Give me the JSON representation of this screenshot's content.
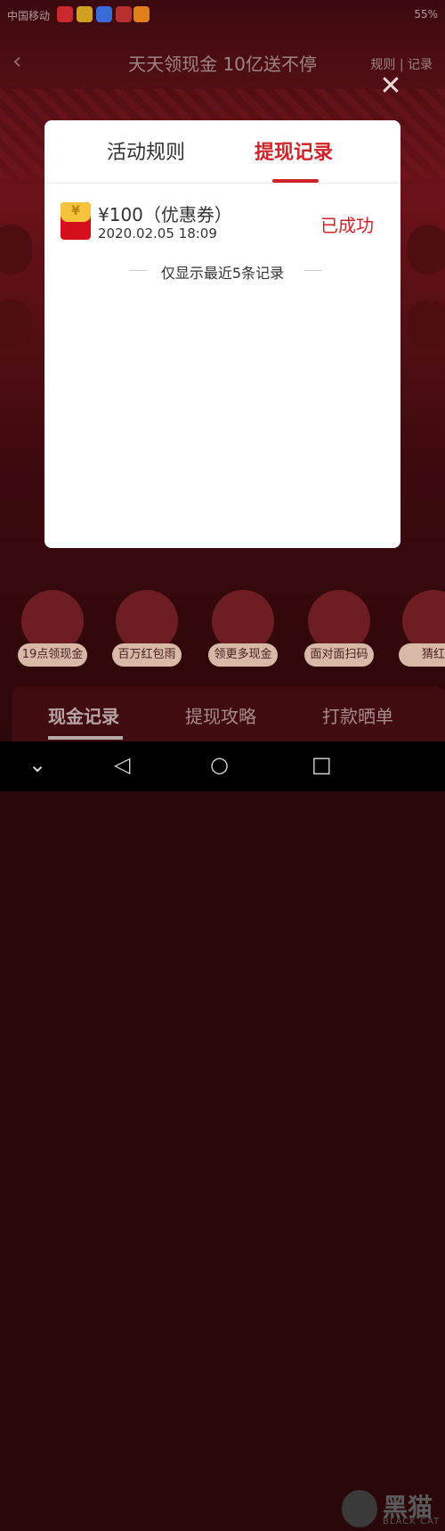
{
  "statusbar": {
    "left_text": "中国移动",
    "right_text": "55%"
  },
  "topbar": {
    "back_glyph": "‹",
    "title": "天天领现金 10亿送不停",
    "links": "规则 | 记录"
  },
  "close_glyph": "✕",
  "modal": {
    "tabs": [
      {
        "label": "活动规则"
      },
      {
        "label": "提现记录"
      }
    ],
    "record": {
      "amount": "¥100（优惠券）",
      "time": "2020.02.05 18:09",
      "status": "已成功",
      "envelope_glyph": "¥"
    },
    "note": "仅显示最近5条记录"
  },
  "features": [
    {
      "label": "19点领现金"
    },
    {
      "label": "百万红包雨"
    },
    {
      "label": "领更多现金"
    },
    {
      "label": "面对面扫码"
    },
    {
      "label": "猜红"
    }
  ],
  "bottom_tabs": [
    {
      "label": "现金记录"
    },
    {
      "label": "提现攻略"
    },
    {
      "label": "打款晒单"
    }
  ],
  "navbar": {
    "collapse": "⌄",
    "back": "◁",
    "home": "○",
    "recent": "□"
  },
  "watermark": {
    "text": "黑猫",
    "sub": "BLACK CAT"
  },
  "colors": {
    "accent": "#d02329",
    "background": "#3a0a0e"
  }
}
